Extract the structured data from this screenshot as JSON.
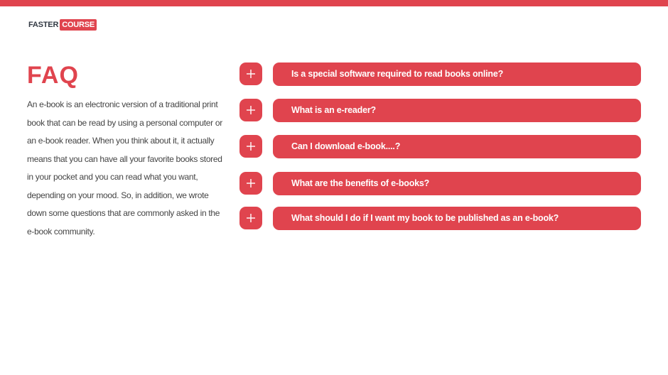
{
  "brand": {
    "logo_part1": "FASTER",
    "logo_part2": "COURSE",
    "accent_color": "#e0444e"
  },
  "page": {
    "title": "FAQ",
    "intro": "An e-book is an electronic version of a traditional print book that can be read by using a personal computer or an e-book reader. When you think about it, it actually means that you can have all your favorite books stored in your pocket and you can read what you want, depending on your mood. So, in addition, we wrote down some questions that are commonly asked in the e-book community."
  },
  "faq": {
    "expand_icon": "plus-icon",
    "items": [
      {
        "question": "Is a special software required to read books online?"
      },
      {
        "question": "What is an e-reader?"
      },
      {
        "question": "Can I download e-book....?"
      },
      {
        "question": "What are the benefits of e-books?"
      },
      {
        "question": "What should I do if I want my book to be published as an e-book?"
      }
    ]
  }
}
